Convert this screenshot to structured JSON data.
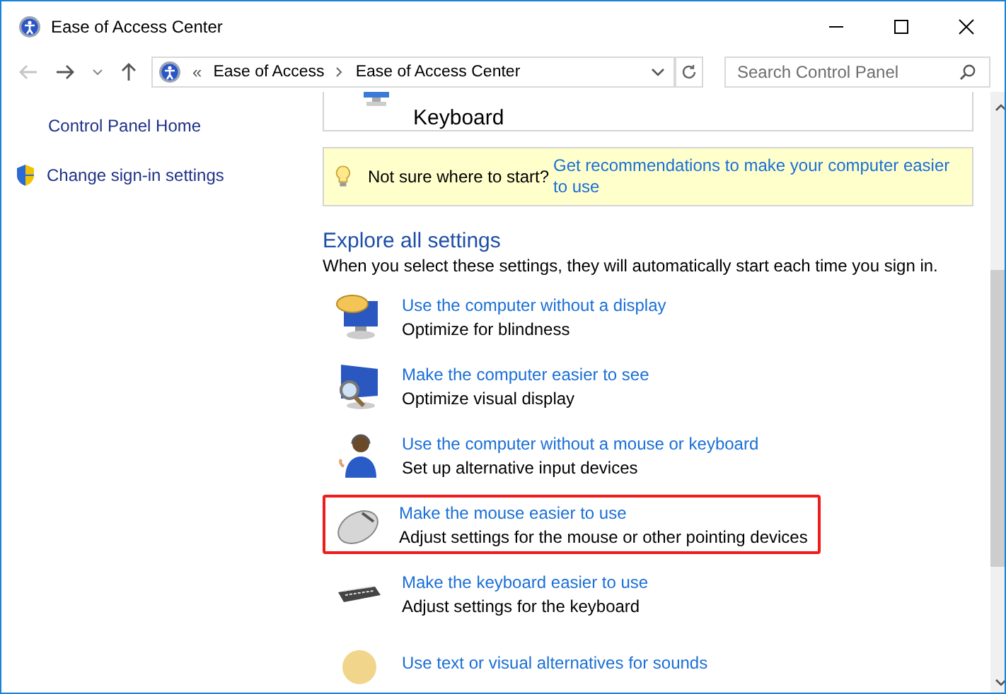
{
  "window": {
    "title": "Ease of Access Center"
  },
  "address_bar": {
    "overflow": "«",
    "path": [
      "Ease of Access",
      "Ease of Access Center"
    ]
  },
  "search": {
    "placeholder": "Search Control Panel"
  },
  "sidebar": {
    "items": [
      {
        "label": "Control Panel Home",
        "kind": "link"
      },
      {
        "label": "Change sign-in settings",
        "kind": "shield"
      }
    ]
  },
  "top_panel": {
    "tile_label": "Keyboard"
  },
  "tip": {
    "prompt": "Not sure where to start?",
    "link": "Get recommendations to make your computer easier to use"
  },
  "explore": {
    "heading": "Explore all settings",
    "description": "When you select these settings, they will automatically start each time you sign in."
  },
  "settings": [
    {
      "kind": "display",
      "link": "Use the computer without a display",
      "description": "Optimize for blindness",
      "highlighted": false
    },
    {
      "kind": "magnifier",
      "link": "Make the computer easier to see",
      "description": "Optimize visual display",
      "highlighted": false
    },
    {
      "kind": "person",
      "link": "Use the computer without a mouse or keyboard",
      "description": "Set up alternative input devices",
      "highlighted": false
    },
    {
      "kind": "mouse",
      "link": "Make the mouse easier to use",
      "description": "Adjust settings for the mouse or other pointing devices",
      "highlighted": true
    },
    {
      "kind": "keyboard",
      "link": "Make the keyboard easier to use",
      "description": "Adjust settings for the keyboard",
      "highlighted": false
    },
    {
      "kind": "sound",
      "link": "Use text or visual alternatives for sounds",
      "highlighted": false
    }
  ]
}
